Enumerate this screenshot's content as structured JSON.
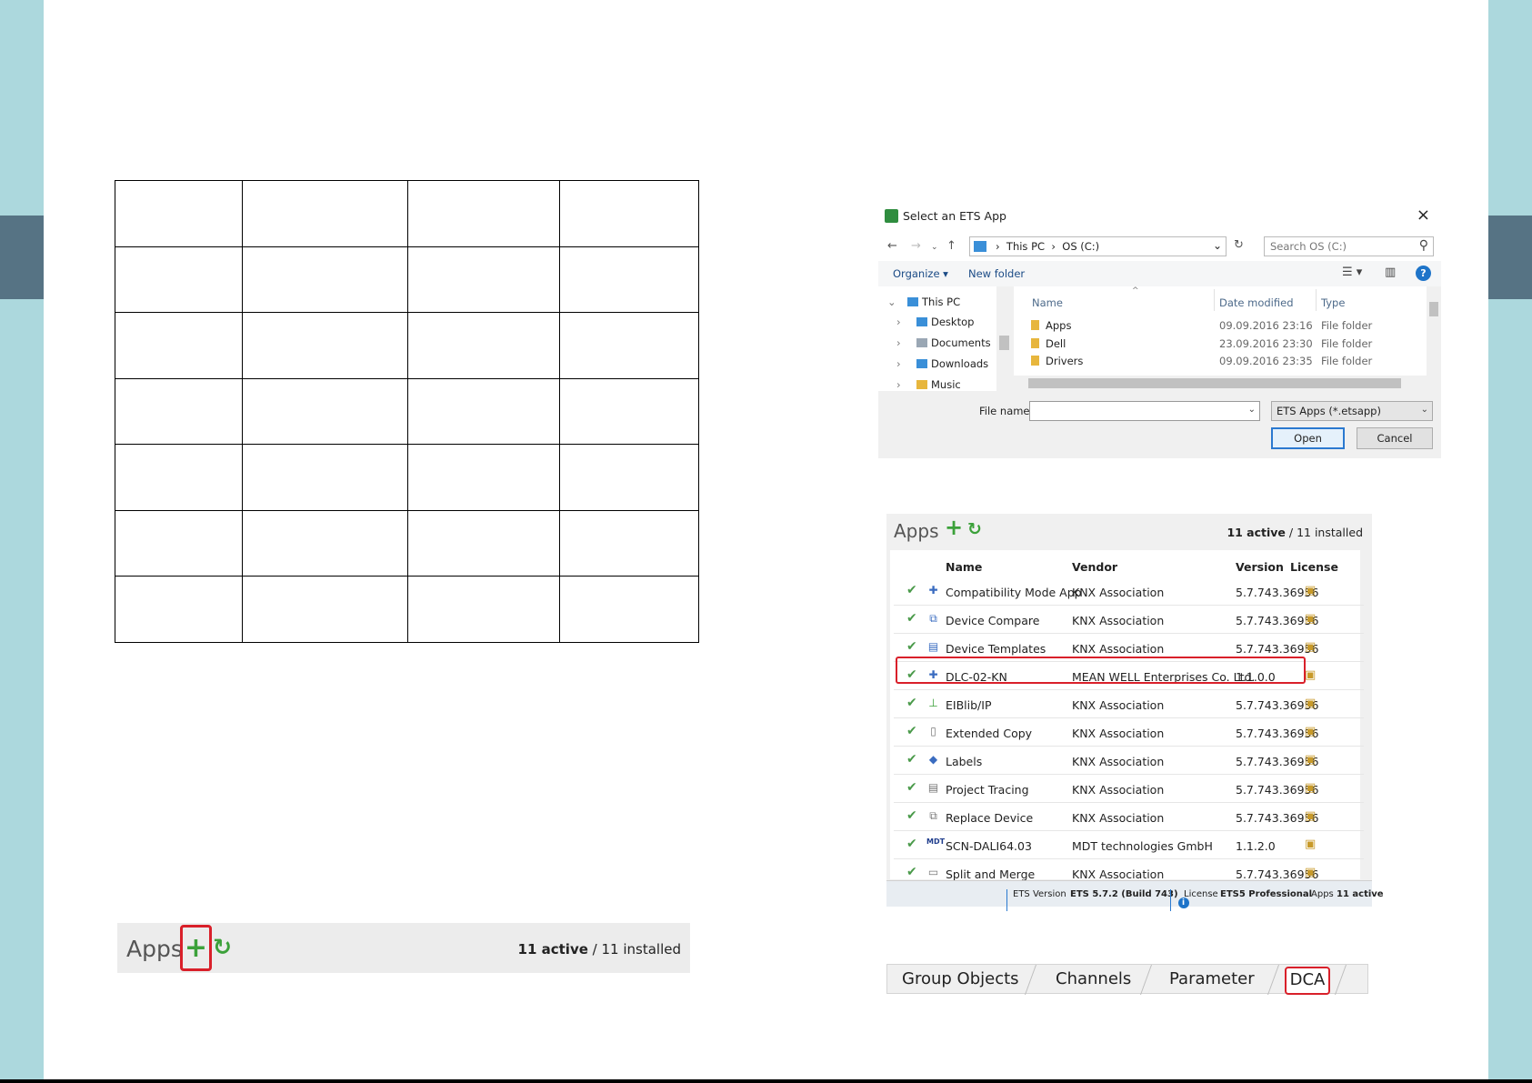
{
  "file_dialog": {
    "title": "Select an ETS App",
    "close_glyph": "×",
    "address": [
      "This PC",
      "OS (C:)"
    ],
    "search_placeholder": "Search OS (C:)",
    "toolbar": {
      "organize": "Organize ▾",
      "new_folder": "New folder"
    },
    "tree": [
      {
        "label": "This PC",
        "chevron": "⌄"
      },
      {
        "label": "Desktop",
        "chevron": "›"
      },
      {
        "label": "Documents",
        "chevron": "›"
      },
      {
        "label": "Downloads",
        "chevron": "›"
      },
      {
        "label": "Music",
        "chevron": "›"
      }
    ],
    "columns": {
      "name": "Name",
      "date": "Date modified",
      "type": "Type"
    },
    "files": [
      {
        "name": "Apps",
        "date": "09.09.2016 23:16",
        "type": "File folder"
      },
      {
        "name": "Dell",
        "date": "23.09.2016 23:30",
        "type": "File folder"
      },
      {
        "name": "Drivers",
        "date": "09.09.2016 23:35",
        "type": "File folder"
      }
    ],
    "file_name_label": "File name:",
    "file_name_value": "",
    "file_type": "ETS Apps (*.etsapp)",
    "open_label": "Open",
    "cancel_label": "Cancel",
    "help_glyph": "?"
  },
  "apps_bar": {
    "title": "Apps",
    "active": "11 active",
    "installed": " / 11 installed"
  },
  "apps_panel": {
    "title": "Apps",
    "active": "11 active",
    "installed": " / 11 installed",
    "columns": {
      "name": "Name",
      "vendor": "Vendor",
      "version": "Version",
      "license": "License"
    },
    "rows": [
      {
        "name": "Compatibility Mode App",
        "vendor": "KNX Association",
        "version": "5.7.743.36956"
      },
      {
        "name": "Device Compare",
        "vendor": "KNX Association",
        "version": "5.7.743.36956"
      },
      {
        "name": "Device Templates",
        "vendor": "KNX Association",
        "version": "5.7.743.36956"
      },
      {
        "name": "DLC-02-KN",
        "vendor": "MEAN WELL Enterprises Co. Ltd.",
        "version": "1.1.0.0"
      },
      {
        "name": "EIBlib/IP",
        "vendor": "KNX Association",
        "version": "5.7.743.36956"
      },
      {
        "name": "Extended Copy",
        "vendor": "KNX Association",
        "version": "5.7.743.36956"
      },
      {
        "name": "Labels",
        "vendor": "KNX Association",
        "version": "5.7.743.36956"
      },
      {
        "name": "Project Tracing",
        "vendor": "KNX Association",
        "version": "5.7.743.36956"
      },
      {
        "name": "Replace Device",
        "vendor": "KNX Association",
        "version": "5.7.743.36956"
      },
      {
        "name": "SCN-DALI64.03",
        "vendor": "MDT technologies GmbH",
        "version": "1.1.2.0"
      },
      {
        "name": "Split and Merge",
        "vendor": "KNX Association",
        "version": "5.7.743.36956"
      }
    ],
    "status": {
      "ets_version_label": "ETS Version",
      "ets_version_value": "ETS 5.7.2 (Build 743)",
      "license_label": "License",
      "license_value": "ETS5 Professional",
      "apps_label": "Apps",
      "apps_value": "11 active"
    },
    "info_glyph": "i"
  },
  "tabs": [
    "Group Objects",
    "Channels",
    "Parameter",
    "DCA"
  ],
  "colors": {
    "teal": "#acd8dd",
    "slate": "#567384",
    "highlight_red": "#d9202a",
    "green": "#3ca13a"
  }
}
